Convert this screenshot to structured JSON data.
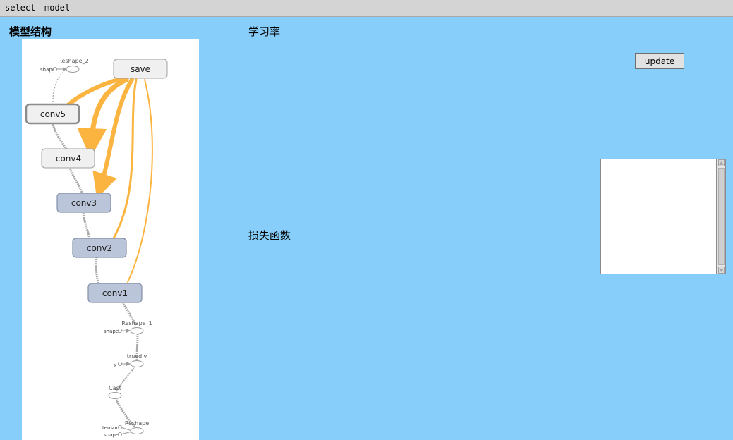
{
  "menubar": {
    "items": [
      "select",
      "model"
    ]
  },
  "sections": {
    "model_structure_title": "模型结构",
    "learning_rate_title": "学习率",
    "loss_function_title": "损失函数"
  },
  "buttons": {
    "update_label": "update"
  },
  "graph": {
    "nodes": {
      "save": "save",
      "conv5": "conv5",
      "conv4": "conv4",
      "conv3": "conv3",
      "conv2": "conv2",
      "conv1": "conv1",
      "reshape_2": "Reshape_2",
      "reshape_1": "Reshape_1",
      "truediv": "truediv",
      "cast": "Cast",
      "reshape": "Reshape"
    },
    "inputs": {
      "shape_top": "shape",
      "shape_mid": "shape",
      "y": "y",
      "tensor": "tensor",
      "shape_bottom": "shape"
    },
    "colors": {
      "highlight_node": "#bac5d9",
      "plain_node": "#f0f0f0",
      "save_edge": "#fbb440"
    }
  },
  "textbox": {
    "value": ""
  },
  "icons": {
    "scroll_up": "triangle-up-icon",
    "scroll_down": "triangle-down-icon"
  }
}
